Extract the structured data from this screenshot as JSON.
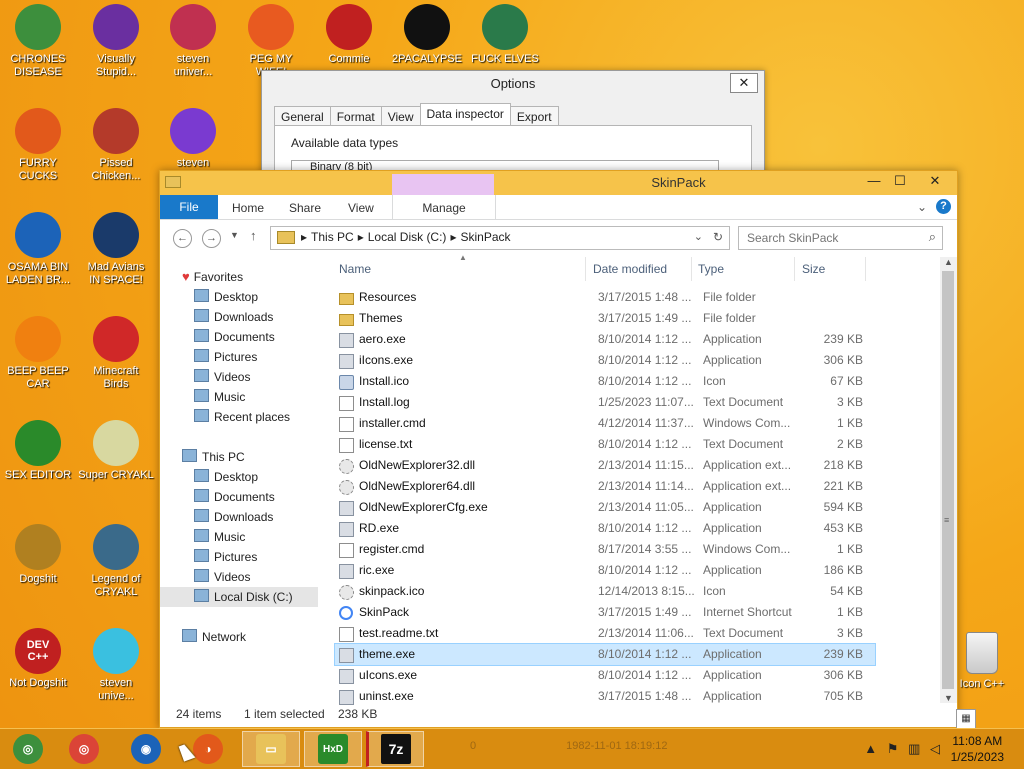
{
  "desktop": {
    "icons": [
      {
        "label": "CHRONES\nDISEASE",
        "icon": "chrome-icon",
        "color": "#3d8f3d"
      },
      {
        "label": "Visually\nStupid...",
        "icon": "visual-studio-icon",
        "color": "#6a2fa0"
      },
      {
        "label": "steven\nuniver...",
        "icon": "steven-universe-icon",
        "color": "#c03050"
      },
      {
        "label": "PEG MY WIFE!",
        "icon": "peggle-icon",
        "color": "#e85a20"
      },
      {
        "label": "Commie",
        "icon": "commie-icon",
        "color": "#c02020"
      },
      {
        "label": "2PACALYPSE",
        "icon": "cmd-icon",
        "color": "#111111"
      },
      {
        "label": "FUCK ELVES",
        "icon": "elves-icon",
        "color": "#2a7a4a"
      },
      {
        "label": "FURRY CUCKS",
        "icon": "firefox-icon",
        "color": "#e2591b"
      },
      {
        "label": "Pissed\nChicken...",
        "icon": "angry-birds-seasons-icon",
        "color": "#b43a2a"
      },
      {
        "label": "steven",
        "icon": "gem-icon",
        "color": "#7a3ad0"
      },
      {
        "label": "OSAMA BIN\nLADEN BR...",
        "icon": "obama-icon",
        "color": "#1c63b8"
      },
      {
        "label": "Mad Avians\nIN SPACE!",
        "icon": "angry-birds-space-icon",
        "color": "#1a3a6a"
      },
      {
        "label": "BEEP BEEP\nCAR",
        "icon": "vlc-icon",
        "color": "#f08010"
      },
      {
        "label": "Minecraft\nBirds",
        "icon": "angry-birds-icon",
        "color": "#d02828"
      },
      {
        "label": "SEX EDITOR",
        "icon": "hxd-icon",
        "color": "#2a8a2a"
      },
      {
        "label": "Super CRYAKL",
        "icon": "cryakl-icon",
        "color": "#d8d8a0"
      },
      {
        "label": "Dogshit",
        "icon": "dogshit-icon",
        "color": "#b08020"
      },
      {
        "label": "Legend of\nCRYAKL",
        "icon": "legend-icon",
        "color": "#3a6a8a"
      },
      {
        "label": "DEV\nC++",
        "icon": "devcpp-icon",
        "color": "#c02020"
      },
      {
        "label": "Not Dogshit",
        "icon": "label",
        "color": "#c02020"
      },
      {
        "label": "steven\nunive...",
        "icon": "diamond-icon",
        "color": "#3ac0e0"
      }
    ],
    "recycle_bin_label": "Icon C++"
  },
  "options_dialog": {
    "title": "Options",
    "close": "✕",
    "tabs": [
      "General",
      "Format",
      "View",
      "Data inspector",
      "Export"
    ],
    "active_tab": "Data inspector",
    "group_label": "Available data types",
    "first_item": "Binary (8 bit)"
  },
  "explorer": {
    "title": "SkinPack",
    "minimize": "—",
    "maximize": "☐",
    "close": "✕",
    "ribbon": {
      "file": "File",
      "home": "Home",
      "share": "Share",
      "view": "View",
      "manage": "Manage"
    },
    "address": {
      "crumbs": [
        "This PC",
        "Local Disk (C:)",
        "SkinPack"
      ]
    },
    "search": {
      "placeholder": "Search SkinPack"
    },
    "nav": {
      "favorites_label": "Favorites",
      "favorites": [
        "Desktop",
        "Downloads",
        "Documents",
        "Pictures",
        "Videos",
        "Music",
        "Recent places"
      ],
      "thispc_label": "This PC",
      "thispc": [
        "Desktop",
        "Documents",
        "Downloads",
        "Music",
        "Pictures",
        "Videos",
        "Local Disk (C:)"
      ],
      "network_label": "Network"
    },
    "columns": {
      "name": "Name",
      "date": "Date modified",
      "type": "Type",
      "size": "Size"
    },
    "files": [
      {
        "name": "Resources",
        "date": "3/17/2015 1:48 ...",
        "type": "File folder",
        "size": "",
        "kind": "folder"
      },
      {
        "name": "Themes",
        "date": "3/17/2015 1:49 ...",
        "type": "File folder",
        "size": "",
        "kind": "folder"
      },
      {
        "name": "aero.exe",
        "date": "8/10/2014 1:12 ...",
        "type": "Application",
        "size": "239 KB",
        "kind": "exe"
      },
      {
        "name": "iIcons.exe",
        "date": "8/10/2014 1:12 ...",
        "type": "Application",
        "size": "306 KB",
        "kind": "exe"
      },
      {
        "name": "Install.ico",
        "date": "8/10/2014 1:12 ...",
        "type": "Icon",
        "size": "67 KB",
        "kind": "ico"
      },
      {
        "name": "Install.log",
        "date": "1/25/2023 11:07...",
        "type": "Text Document",
        "size": "3 KB",
        "kind": "doc"
      },
      {
        "name": "installer.cmd",
        "date": "4/12/2014 11:37...",
        "type": "Windows Com...",
        "size": "1 KB",
        "kind": "doc"
      },
      {
        "name": "license.txt",
        "date": "8/10/2014 1:12 ...",
        "type": "Text Document",
        "size": "2 KB",
        "kind": "doc"
      },
      {
        "name": "OldNewExplorer32.dll",
        "date": "2/13/2014 11:15...",
        "type": "Application ext...",
        "size": "218 KB",
        "kind": "dll"
      },
      {
        "name": "OldNewExplorer64.dll",
        "date": "2/13/2014 11:14...",
        "type": "Application ext...",
        "size": "221 KB",
        "kind": "dll"
      },
      {
        "name": "OldNewExplorerCfg.exe",
        "date": "2/13/2014 11:05...",
        "type": "Application",
        "size": "594 KB",
        "kind": "exe"
      },
      {
        "name": "RD.exe",
        "date": "8/10/2014 1:12 ...",
        "type": "Application",
        "size": "453 KB",
        "kind": "exe"
      },
      {
        "name": "register.cmd",
        "date": "8/17/2014 3:55 ...",
        "type": "Windows Com...",
        "size": "1 KB",
        "kind": "doc"
      },
      {
        "name": "ric.exe",
        "date": "8/10/2014 1:12 ...",
        "type": "Application",
        "size": "186 KB",
        "kind": "exe"
      },
      {
        "name": "skinpack.ico",
        "date": "12/14/2013 8:15...",
        "type": "Icon",
        "size": "54 KB",
        "kind": "dll"
      },
      {
        "name": "SkinPack",
        "date": "3/17/2015 1:49 ...",
        "type": "Internet Shortcut",
        "size": "1 KB",
        "kind": "url"
      },
      {
        "name": "test.readme.txt",
        "date": "2/13/2014 11:06...",
        "type": "Text Document",
        "size": "3 KB",
        "kind": "doc"
      },
      {
        "name": "theme.exe",
        "date": "8/10/2014 1:12 ...",
        "type": "Application",
        "size": "239 KB",
        "kind": "exe",
        "selected": true
      },
      {
        "name": "uIcons.exe",
        "date": "8/10/2014 1:12 ...",
        "type": "Application",
        "size": "306 KB",
        "kind": "exe"
      },
      {
        "name": "uninst.exe",
        "date": "3/17/2015 1:48 ...",
        "type": "Application",
        "size": "705 KB",
        "kind": "exe"
      }
    ],
    "status": {
      "items": "24 items",
      "selected": "1 item selected",
      "size": "238 KB"
    }
  },
  "taskbar": {
    "ghost_text": [
      "0",
      "1982-11-01 18:19:12"
    ],
    "clock_time": "11:08 AM",
    "clock_date": "1/25/2023",
    "seven_zip_label": "7z",
    "hxd_label": "HxD"
  }
}
